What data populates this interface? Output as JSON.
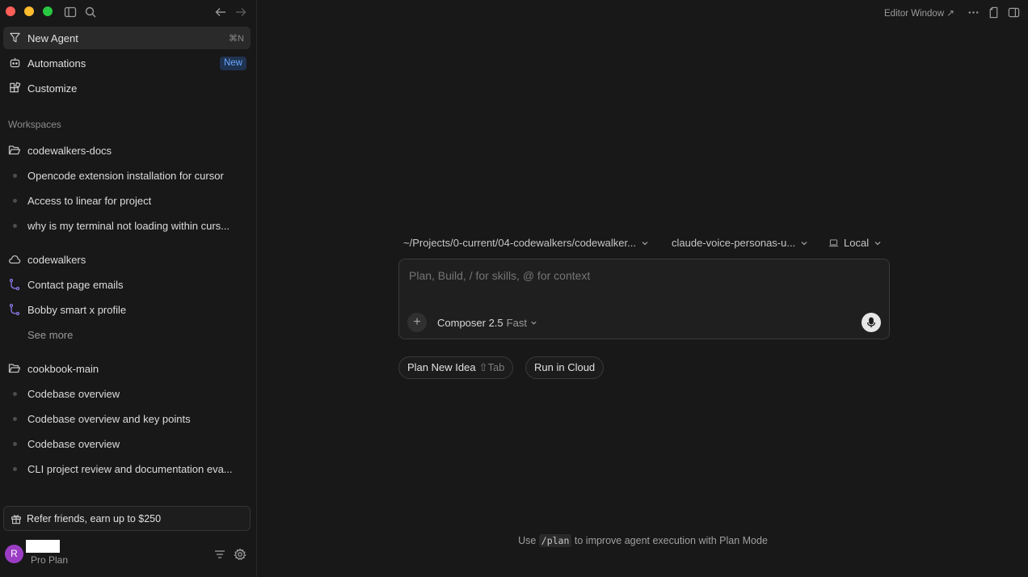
{
  "sidebar": {
    "new_agent": {
      "label": "New Agent",
      "shortcut": "⌘N"
    },
    "automations": {
      "label": "Automations",
      "badge": "New"
    },
    "customize": {
      "label": "Customize"
    },
    "workspaces_title": "Workspaces",
    "workspaces": [
      {
        "name": "codewalkers-docs",
        "icon": "folder-icon",
        "items": [
          "Opencode extension installation for cursor",
          "Access to linear for project",
          "why is my terminal not loading within curs..."
        ]
      },
      {
        "name": "codewalkers",
        "icon": "cloud-icon",
        "items": [
          "Contact page emails",
          "Bobby smart x profile"
        ],
        "see_more": "See more"
      },
      {
        "name": "cookbook-main",
        "icon": "folder-icon",
        "items": [
          "Codebase overview",
          "Codebase overview and key points",
          "Codebase overview",
          "CLI project review and documentation eva..."
        ]
      }
    ],
    "refer": "Refer friends, earn up to $250",
    "user": {
      "avatar_initial": "R",
      "plan": "Pro Plan"
    }
  },
  "main": {
    "editor_window": "Editor Window ↗",
    "path": "~/Projects/0-current/04-codewalkers/codewalker...",
    "branch": "claude-voice-personas-u...",
    "location": "Local",
    "composer": {
      "placeholder": "Plan, Build, / for skills, @ for context",
      "model": "Composer 2.5",
      "mode": "Fast"
    },
    "chips": {
      "plan_label": "Plan New Idea",
      "plan_hint": "⇧Tab",
      "cloud_label": "Run in Cloud"
    },
    "tip": {
      "pre": "Use",
      "code": "/plan",
      "post": "to improve agent execution with Plan Mode"
    }
  },
  "colors": {
    "background": "#181818",
    "accent": "#6aa6ff",
    "branch": "#8b78e6",
    "avatar": "#9b3dc4"
  }
}
